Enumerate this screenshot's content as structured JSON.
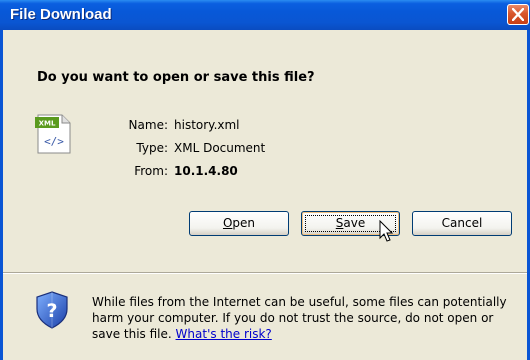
{
  "window": {
    "title": "File Download"
  },
  "dialog": {
    "question": "Do you want to open or save this file?",
    "file_icon": "xml-file-icon",
    "file_icon_badge": "XML",
    "fields": {
      "name_label": "Name:",
      "name_value": "history.xml",
      "type_label": "Type:",
      "type_value": "XML Document",
      "from_label": "From:",
      "from_value": "10.1.4.80"
    },
    "buttons": {
      "open_first": "O",
      "open_rest": "pen",
      "save_first": "S",
      "save_rest": "ave",
      "cancel": "Cancel"
    },
    "warning": {
      "text": "While files from the Internet can be useful, some files can potentially harm your computer. If you do not trust the source, do not open or save this file.",
      "link": "What's the risk?"
    }
  },
  "colors": {
    "titlebar": "#0a5fe0",
    "dialog_bg": "#ece9d8",
    "close_button": "#d8562c",
    "link": "#0000cc"
  }
}
